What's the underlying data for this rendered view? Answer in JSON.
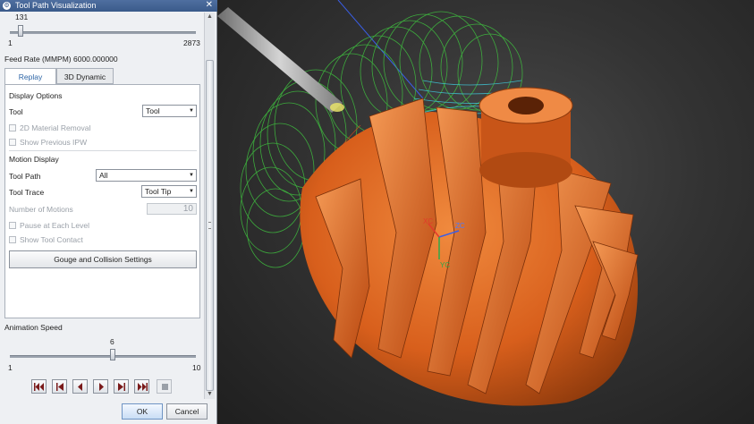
{
  "window": {
    "title": "Tool Path Visualization"
  },
  "motion_slider": {
    "value": "131",
    "min": "1",
    "max": "2873",
    "fraction": 0.0453
  },
  "feed_rate": {
    "label": "Feed Rate (MMPM) 6000.000000"
  },
  "tabs": [
    {
      "label": "Replay",
      "active": true
    },
    {
      "label": "3D Dynamic",
      "active": false
    }
  ],
  "display_options": {
    "section_label": "Display Options",
    "tool": {
      "label": "Tool",
      "value": "Tool"
    },
    "material_removal": {
      "label": "2D Material Removal",
      "checked": false
    },
    "previous_ipw": {
      "label": "Show Previous IPW",
      "checked": false
    }
  },
  "motion_display": {
    "section_label": "Motion Display",
    "tool_path": {
      "label": "Tool Path",
      "value": "All"
    },
    "tool_trace": {
      "label": "Tool Trace",
      "value": "Tool Tip"
    },
    "number_of_motions": {
      "label": "Number of Motions",
      "value": "10"
    },
    "pause_each_level": {
      "label": "Pause at Each Level",
      "checked": false
    },
    "show_tool_contact": {
      "label": "Show Tool Contact",
      "checked": false
    },
    "gouge_button": "Gouge and Collision Settings"
  },
  "animation_speed": {
    "label": "Animation Speed",
    "value": "6",
    "min": "1",
    "max": "10",
    "fraction": 0.5556
  },
  "playback": {
    "buttons": [
      "rewind-to-start",
      "step-back",
      "play-reverse",
      "play-forward",
      "step-forward",
      "fast-forward-to-end",
      "stop"
    ]
  },
  "footer": {
    "ok": "OK",
    "cancel": "Cancel"
  },
  "viewport": {
    "axis_labels": {
      "xc": "XC",
      "yc": "YC",
      "zc": "ZC"
    },
    "colors": {
      "part": "#e0661f",
      "part_shadow": "#9c3f0d",
      "toolpath_green": "#3fbf3f",
      "toolpath_cyan": "#3fc6d6",
      "tool": "#b8b8b8"
    }
  }
}
